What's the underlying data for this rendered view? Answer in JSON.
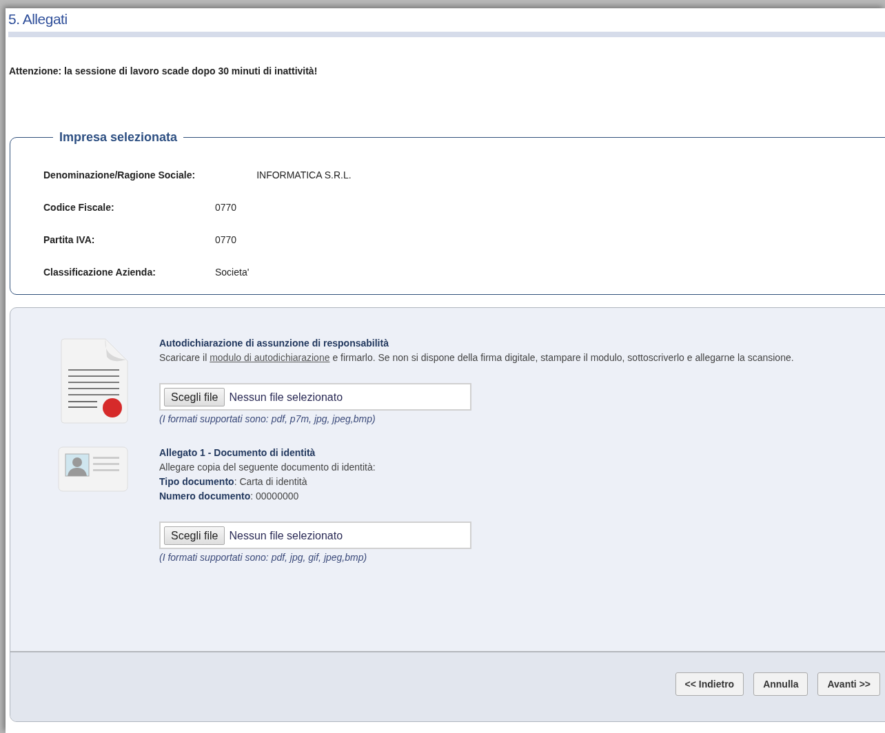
{
  "page_title": "5. Allegati",
  "warning": "Attenzione: la sessione di lavoro scade dopo 30 minuti di inattività!",
  "company": {
    "legend": "Impresa selezionata",
    "fields": [
      {
        "label": "Denominazione/Ragione Sociale:",
        "value": "INFORMATICA S.R.L."
      },
      {
        "label": "Codice Fiscale:",
        "value": "0770"
      },
      {
        "label": "Partita IVA:",
        "value": "0770"
      },
      {
        "label": "Classificazione Azienda:",
        "value": "Societa'"
      }
    ]
  },
  "attachments": [
    {
      "kind": "document",
      "title": "Autodichiarazione di assunzione di responsabilità",
      "description": {
        "before": "Scaricare il",
        "link": "modulo di autodichiarazione",
        "after": "e firmarlo. Se non si dispone della firma digitale, stampare il modulo, sottoscriverlo e allegarne la scansione."
      },
      "file_button": "Scegli file",
      "file_status": "Nessun file selezionato",
      "formats": "(I formati supportati sono: pdf, p7m, jpg, jpeg,bmp)"
    },
    {
      "kind": "id_card",
      "title": "Allegato 1 - Documento di identità",
      "lines": [
        "Allegare copia del seguente documento di identità:",
        "**Tipo documento**: Carta di identità",
        "**Numero documento**: 00000000"
      ],
      "file_button": "Scegli file",
      "file_status": "Nessun file selezionato",
      "formats": "(I formati supportati sono: pdf, jpg, gif, jpeg,bmp)"
    }
  ],
  "buttons": [
    "<< Indietro",
    "Annulla",
    "Avanti >>"
  ]
}
